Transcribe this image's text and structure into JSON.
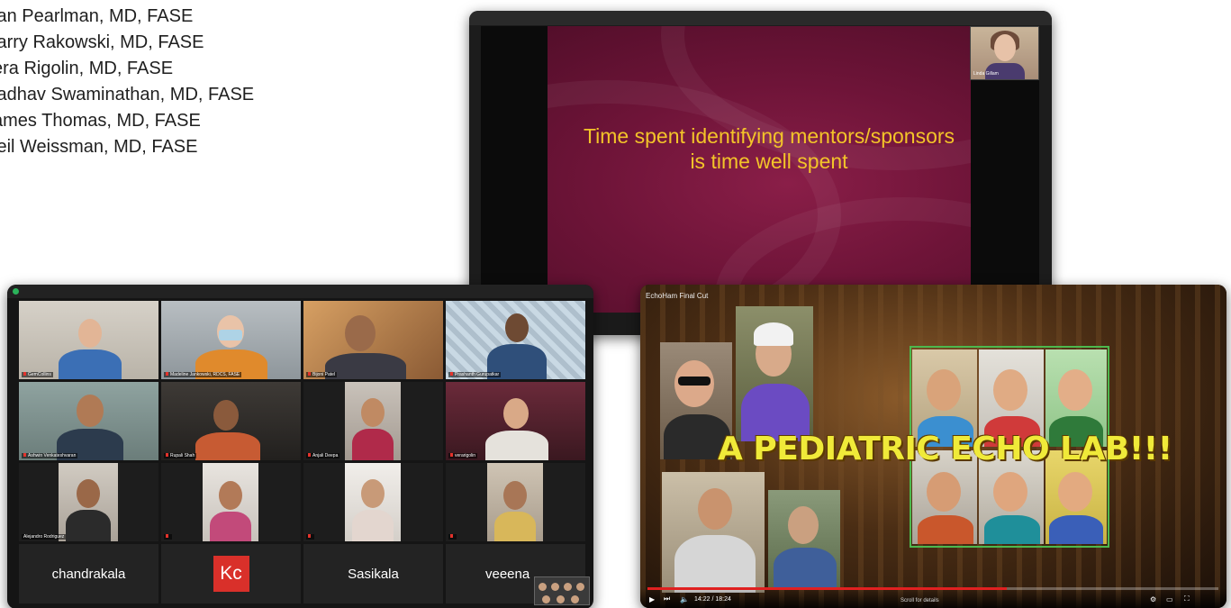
{
  "names": [
    "lan Pearlman, MD, FASE",
    "larry Rakowski, MD, FASE",
    "era Rigolin, MD, FASE",
    "ladhav Swaminathan, MD, FASE",
    "ames Thomas, MD, FASE",
    "leil Weissman, MD, FASE"
  ],
  "slide": {
    "text": "Time spent identifying mentors/sponsors is time well spent",
    "speaker_label": "Linda Gillam"
  },
  "zoom": {
    "tiles": [
      {
        "label": "GemCollins"
      },
      {
        "label": "Madeline Jankowski, RDCS, FASE"
      },
      {
        "label": "Bijoni Patel"
      },
      {
        "label": "Prashanth Gurupatkar"
      },
      {
        "label": "Ashwin Venkateshvaran"
      },
      {
        "label": "Rupali Shah"
      },
      {
        "label": "Anjali Deepa"
      },
      {
        "label": "verarigolin"
      },
      {
        "label": "Alejandro Rodriguez"
      },
      {
        "label": ""
      },
      {
        "label": ""
      },
      {
        "label": ""
      }
    ],
    "named_tiles": [
      {
        "text": "chandrakala"
      },
      {
        "text": "Kc"
      },
      {
        "text": "Sasikala"
      },
      {
        "text": "veeena"
      }
    ]
  },
  "video": {
    "title": "EchoHam Final Cut",
    "caption": "A PEDIATRIC ECHO LAB!!!",
    "time": "14:22 / 18:24",
    "scroll_hint": "Scroll for details",
    "progress": 0.63
  }
}
